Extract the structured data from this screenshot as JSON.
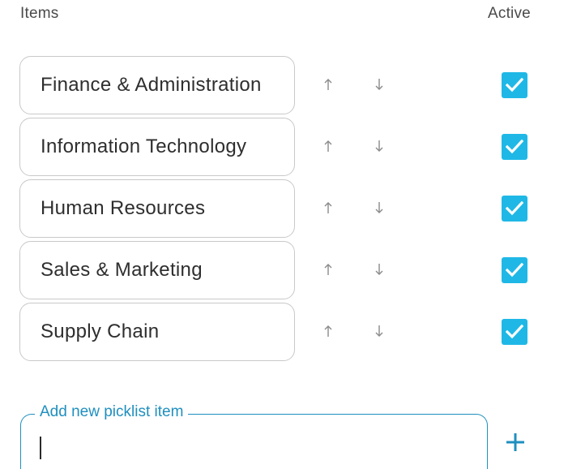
{
  "header": {
    "items_label": "Items",
    "active_label": "Active"
  },
  "items": [
    {
      "label": "Finance & Administration",
      "active": true
    },
    {
      "label": "Information Technology",
      "active": true
    },
    {
      "label": "Human Resources",
      "active": true
    },
    {
      "label": "Sales & Marketing",
      "active": true
    },
    {
      "label": "Supply Chain",
      "active": true
    }
  ],
  "new_item": {
    "label": "Add new picklist item",
    "value": ""
  },
  "icons": {
    "move_up": "arrow-up-icon",
    "move_down": "arrow-down-icon",
    "checked": "check-icon",
    "add": "plus-icon"
  },
  "colors": {
    "accent": "#1f8fbf",
    "checkbox": "#1fb8e6",
    "arrow": "#8a8a8a",
    "border": "#c9c9c9"
  }
}
